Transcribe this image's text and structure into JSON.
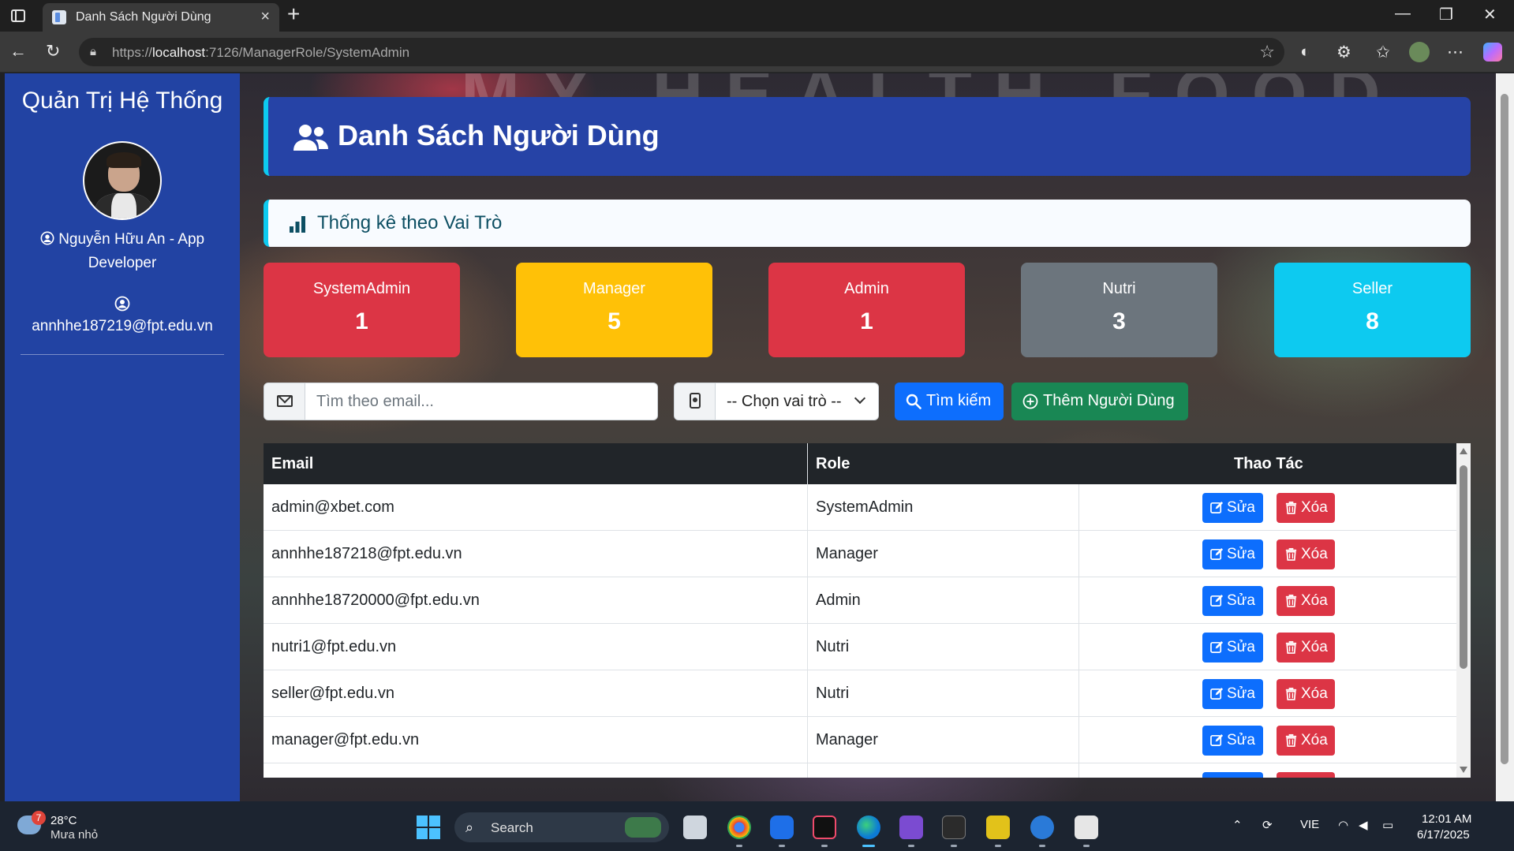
{
  "browser": {
    "tab_title": "Danh Sách Người Dùng",
    "url_prefix": "https://",
    "url_host": "localhost",
    "url_path": ":7126/ManagerRole/SystemAdmin"
  },
  "sidebar": {
    "title": "Quản Trị Hệ Thống",
    "user_name": "Nguyễn Hữu An - App Developer",
    "user_email": "annhhe187219@fpt.edu.vn"
  },
  "background_text": "MY HEALTH FOOD",
  "header": {
    "title": "Danh Sách Người Dùng"
  },
  "stats": {
    "title": "Thống kê theo Vai Trò",
    "roles": [
      {
        "name": "SystemAdmin",
        "count": "1",
        "color": "#dc3545"
      },
      {
        "name": "Manager",
        "count": "5",
        "color": "#ffc107"
      },
      {
        "name": "Admin",
        "count": "1",
        "color": "#dc3545"
      },
      {
        "name": "Nutri",
        "count": "3",
        "color": "#6c757d"
      },
      {
        "name": "Seller",
        "count": "8",
        "color": "#0dcaf0"
      }
    ]
  },
  "filters": {
    "email_placeholder": "Tìm theo email...",
    "role_select": "-- Chọn vai trò --",
    "search_button": "Tìm kiếm",
    "add_button": "Thêm Người Dùng"
  },
  "table": {
    "headers": {
      "email": "Email",
      "role": "Role",
      "actions": "Thao Tác"
    },
    "edit_label": "Sửa",
    "delete_label": "Xóa",
    "rows": [
      {
        "email": "admin@xbet.com",
        "role": "SystemAdmin"
      },
      {
        "email": "annhhe187218@fpt.edu.vn",
        "role": "Manager"
      },
      {
        "email": "annhhe18720000@fpt.edu.vn",
        "role": "Admin"
      },
      {
        "email": "nutri1@fpt.edu.vn",
        "role": "Nutri"
      },
      {
        "email": "seller@fpt.edu.vn",
        "role": "Nutri"
      },
      {
        "email": "manager@fpt.edu.vn",
        "role": "Manager"
      }
    ]
  },
  "taskbar": {
    "weather_badge": "7",
    "temperature": "28°C",
    "weather": "Mưa nhỏ",
    "search_label": "Search",
    "language": "VIE",
    "time": "12:01 AM",
    "date": "6/17/2025"
  }
}
